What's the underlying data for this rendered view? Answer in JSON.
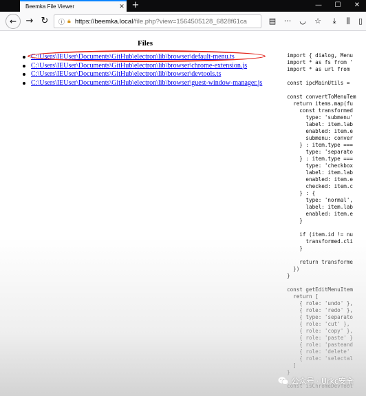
{
  "browser": {
    "tab_title": "Beemka File Viewer",
    "tab_close": "✕",
    "new_tab": "+",
    "window_controls": {
      "minimize": "—",
      "maximize": "☐",
      "close": "✕"
    },
    "url_host": "https://beemka.local",
    "url_path": "/file.php?view=1564505128_6828f61ca",
    "icons": [
      "back-icon",
      "forward-icon",
      "reload-icon",
      "info-icon",
      "lock-icon",
      "reader-icon",
      "more-icon",
      "pocket-icon",
      "star-icon",
      "download-icon",
      "library-icon",
      "sidebar-icon"
    ]
  },
  "page": {
    "heading": "Files",
    "files": [
      "C:\\Users\\IEUser\\Documents\\GitHub\\electron\\lib\\browser\\default-menu.ts",
      "C:\\Users\\IEUser\\Documents\\GitHub\\electron\\lib\\browser\\chrome-extension.js",
      "C:\\Users\\IEUser\\Documents\\GitHub\\electron\\lib\\browser\\devtools.ts",
      "C:\\Users\\IEUser\\Documents\\GitHub\\electron\\lib\\browser\\guest-window-manager.js"
    ],
    "annotation_color": "#e2231a",
    "code": "import { dialog, Menu\nimport * as fs from '\nimport * as url from \n\nconst ipcMainUtils = \n\nconst convertToMenuTem\n  return items.map(fu\n    const transformed\n      type: 'submenu'\n      label: item.lab\n      enabled: item.e\n      submenu: conver\n    } : item.type ===\n      type: 'separato\n    } : item.type ===\n      type: 'checkbox\n      label: item.lab\n      enabled: item.e\n      checked: item.c\n    } : {\n      type: 'normal',\n      label: item.lab\n      enabled: item.e\n    }\n\n    if (item.id != nu\n      transformed.cli\n    }\n\n    return transforme\n  })\n}\n\nconst getEditMenuItem\n  return [\n    { role: 'undo' },\n    { role: 'redo' },\n    { type: 'separato\n    { role: 'cut' },\n    { role: 'copy' },\n    { role: 'paste' }\n    { role: 'pasteand\n    { role: 'delete'\n    { role: 'selectal\n  ]\n}\n\nconst isChromeDevTool",
    "watermark": "公众号 · Urkc安全"
  }
}
